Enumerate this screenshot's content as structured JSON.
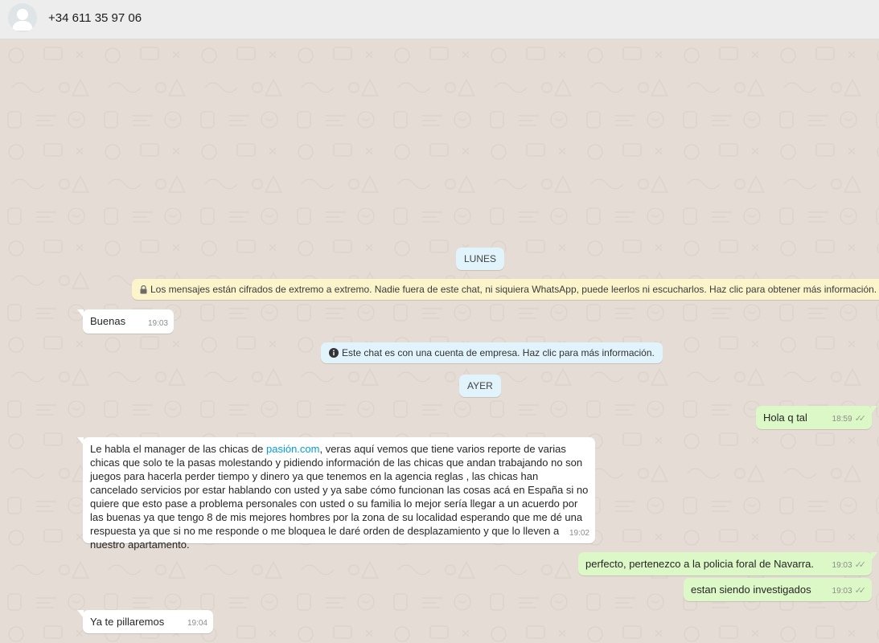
{
  "header": {
    "contact": "+34 611 35 97 06"
  },
  "dates": {
    "monday": "LUNES",
    "yesterday": "AYER"
  },
  "notices": {
    "encryption": "Los mensajes están cifrados de extremo a extremo. Nadie fuera de este chat, ni siquiera WhatsApp, puede leerlos ni escucharlos. Haz clic para obtener más información.",
    "business": "Este chat es con una cuenta de empresa. Haz clic para más información."
  },
  "messages": [
    {
      "direction": "in",
      "text": "Buenas",
      "time": "19:03"
    },
    {
      "direction": "out",
      "text": "Hola q tal",
      "time": "18:59"
    },
    {
      "direction": "in",
      "text_before_link": "Le habla el manager de las chicas de ",
      "link": "pasión.com",
      "text_after_link": ", veras aquí vemos que tiene varios reporte  de varias chicas que solo te la pasas molestando y pidiendo información de las chicas que andan trabajando no son juegos para hacerla perder tiempo y dinero ya que tenemos en la agencia reglas , las chicas han cancelado servicios por estar hablando con usted  y ya sabe cómo funcionan las cosas acá en España si no quiere que esto pase a problema personales con usted o su familia lo mejor sería llegar a un acuerdo por las buenas ya que tengo 8 de mis mejores hombres por la zona de su localidad esperando que me dé una respuesta ya que si no me responde o me bloquea le daré orden de desplazamiento y que lo lleven a nuestro apartamento.",
      "time": "19:02"
    },
    {
      "direction": "out",
      "text": "perfecto, pertenezco a la policia foral de Navarra.",
      "time": "19:03"
    },
    {
      "direction": "out",
      "text": "estan siendo investigados",
      "time": "19:03"
    },
    {
      "direction": "in",
      "text": "Ya te pillaremos",
      "time": "19:04"
    }
  ],
  "colors": {
    "incoming": "#ffffff",
    "outgoing": "#dcf8c6",
    "date_pill": "#e1f3fb",
    "encryption_notice": "#fcf4cb",
    "link": "#039be5",
    "wallpaper": "#e5ddd5"
  },
  "icons": {
    "avatar": "default-user-avatar",
    "lock": "lock-icon",
    "info": "info-icon",
    "ticks": "double-check-icon"
  }
}
